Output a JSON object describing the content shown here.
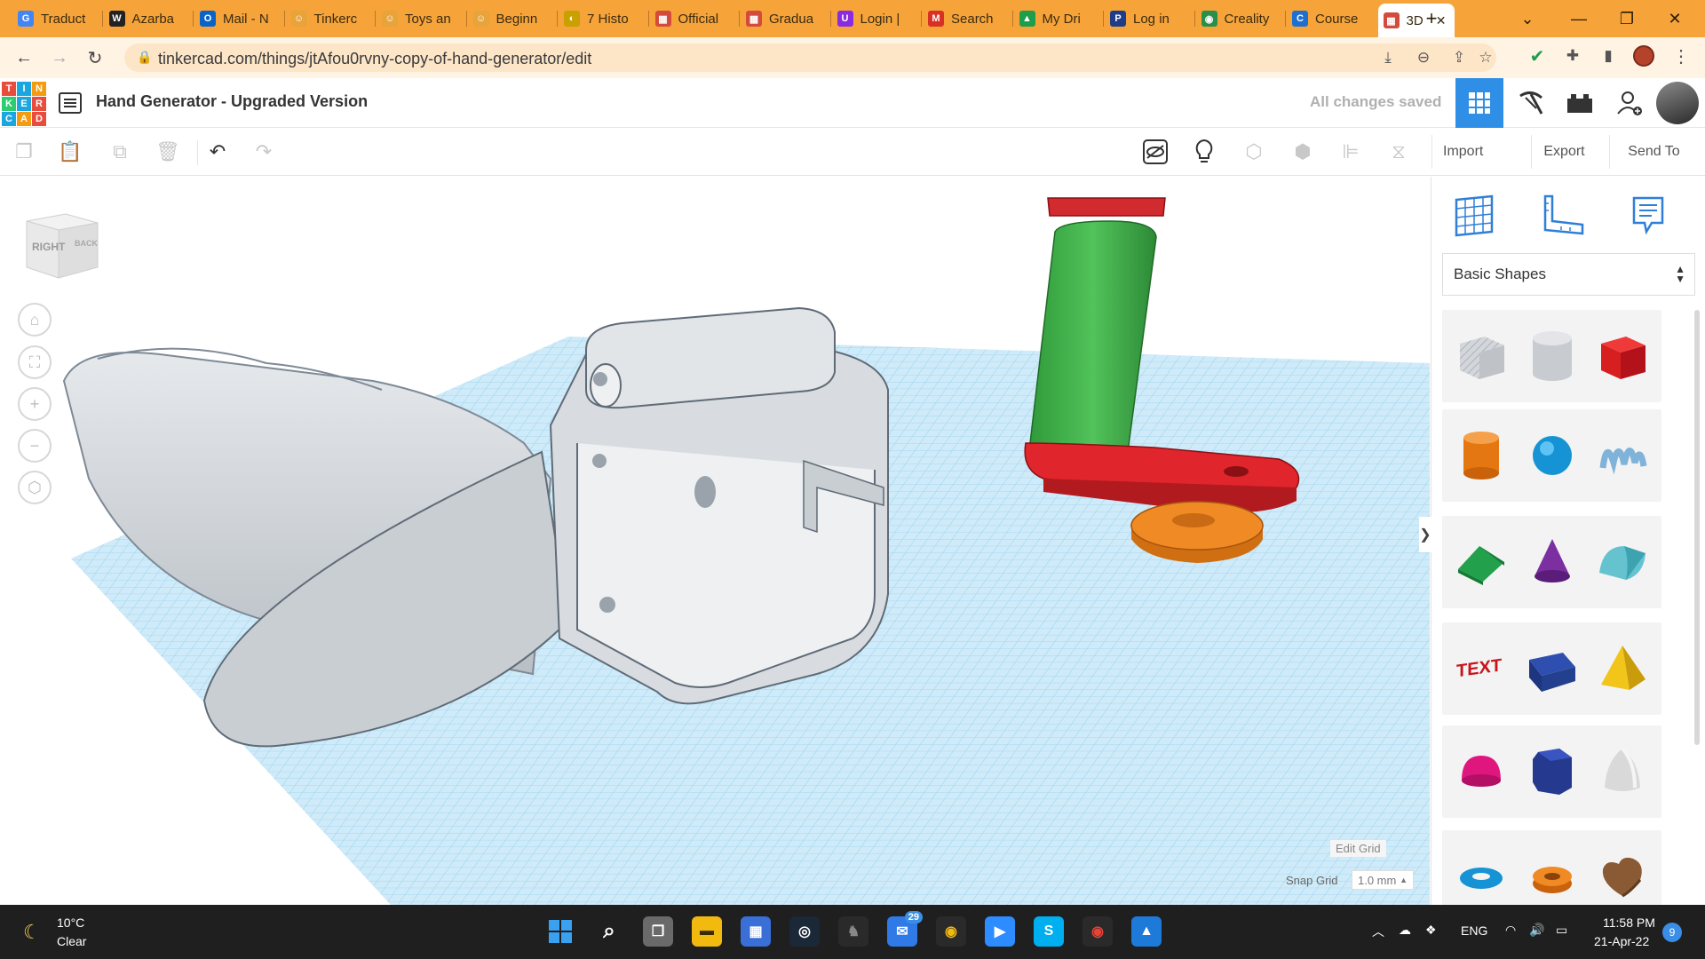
{
  "browser": {
    "tabs": [
      {
        "label": "Traduct",
        "icon": "google-translate-icon",
        "color": "#4285f4",
        "glyph": "G"
      },
      {
        "label": "Azarba",
        "icon": "wikipedia-icon",
        "color": "#222222",
        "glyph": "W"
      },
      {
        "label": "Mail - N",
        "icon": "outlook-icon",
        "color": "#0a64c8",
        "glyph": "O"
      },
      {
        "label": "Tinkerc",
        "icon": "tinkercad-face-icon",
        "color": "#e8a33a",
        "glyph": "☺"
      },
      {
        "label": "Toys an",
        "icon": "tinkercad-face-icon",
        "color": "#e8a33a",
        "glyph": "☺"
      },
      {
        "label": "Beginn",
        "icon": "tinkercad-face-icon",
        "color": "#e8a33a",
        "glyph": "☺"
      },
      {
        "label": "7 Histo",
        "icon": "history-icon",
        "color": "#c8a000",
        "glyph": "◐"
      },
      {
        "label": "Official",
        "icon": "tinkercad-grid-icon",
        "color": "#d24b3d",
        "glyph": "▦"
      },
      {
        "label": "Gradua",
        "icon": "tinkercad-grid-icon",
        "color": "#d24b3d",
        "glyph": "▦"
      },
      {
        "label": "Login |",
        "icon": "udemy-icon",
        "color": "#8a2be2",
        "glyph": "U"
      },
      {
        "label": "Search",
        "icon": "gmail-icon",
        "color": "#d93025",
        "glyph": "M"
      },
      {
        "label": "My Dri",
        "icon": "google-drive-icon",
        "color": "#1e9e4a",
        "glyph": "▲"
      },
      {
        "label": "Log in",
        "icon": "paypal-icon",
        "color": "#1f3c88",
        "glyph": "P"
      },
      {
        "label": "Creality",
        "icon": "chrome-icon",
        "color": "#2a8f4a",
        "glyph": "◉"
      },
      {
        "label": "Course",
        "icon": "coursera-icon",
        "color": "#1f6fd1",
        "glyph": "C"
      },
      {
        "label": "3D",
        "icon": "tinkercad-grid-icon",
        "color": "#d24b3d",
        "glyph": "▦"
      }
    ],
    "close_glyph": "✕",
    "new_tab_glyph": "+",
    "url": "tinkercad.com/things/jtAfou0rvny-copy-of-hand-generator/edit"
  },
  "tinkercad": {
    "logo_letters": [
      "T",
      "I",
      "N",
      "K",
      "E",
      "R",
      "C",
      "A",
      "D"
    ],
    "design_title": "Hand Generator - Upgraded Version",
    "save_status": "All changes saved",
    "toolbar": {
      "import": "Import",
      "export": "Export",
      "send_to": "Send To"
    },
    "view_cube": {
      "right": "RIGHT",
      "back": "BACK"
    },
    "edit_grid": "Edit Grid",
    "snap_grid_label": "Snap Grid",
    "snap_grid_value": "1.0 mm",
    "shape_library": "Basic Shapes",
    "shapes": [
      "box-hole",
      "cylinder-hole",
      "box",
      "cylinder",
      "sphere",
      "scribble",
      "roof",
      "cone",
      "round-roof",
      "text",
      "half-cylinder",
      "pyramid",
      "half-sphere",
      "polygon",
      "paraboloid",
      "torus",
      "tube",
      "heart"
    ],
    "shape_text_label": "TEXT"
  },
  "taskbar": {
    "weather_temp": "10°C",
    "weather_desc": "Clear",
    "mail_badge": "29",
    "language": "ENG",
    "time": "11:58 PM",
    "date": "21-Apr-22",
    "notification_count": "9"
  }
}
